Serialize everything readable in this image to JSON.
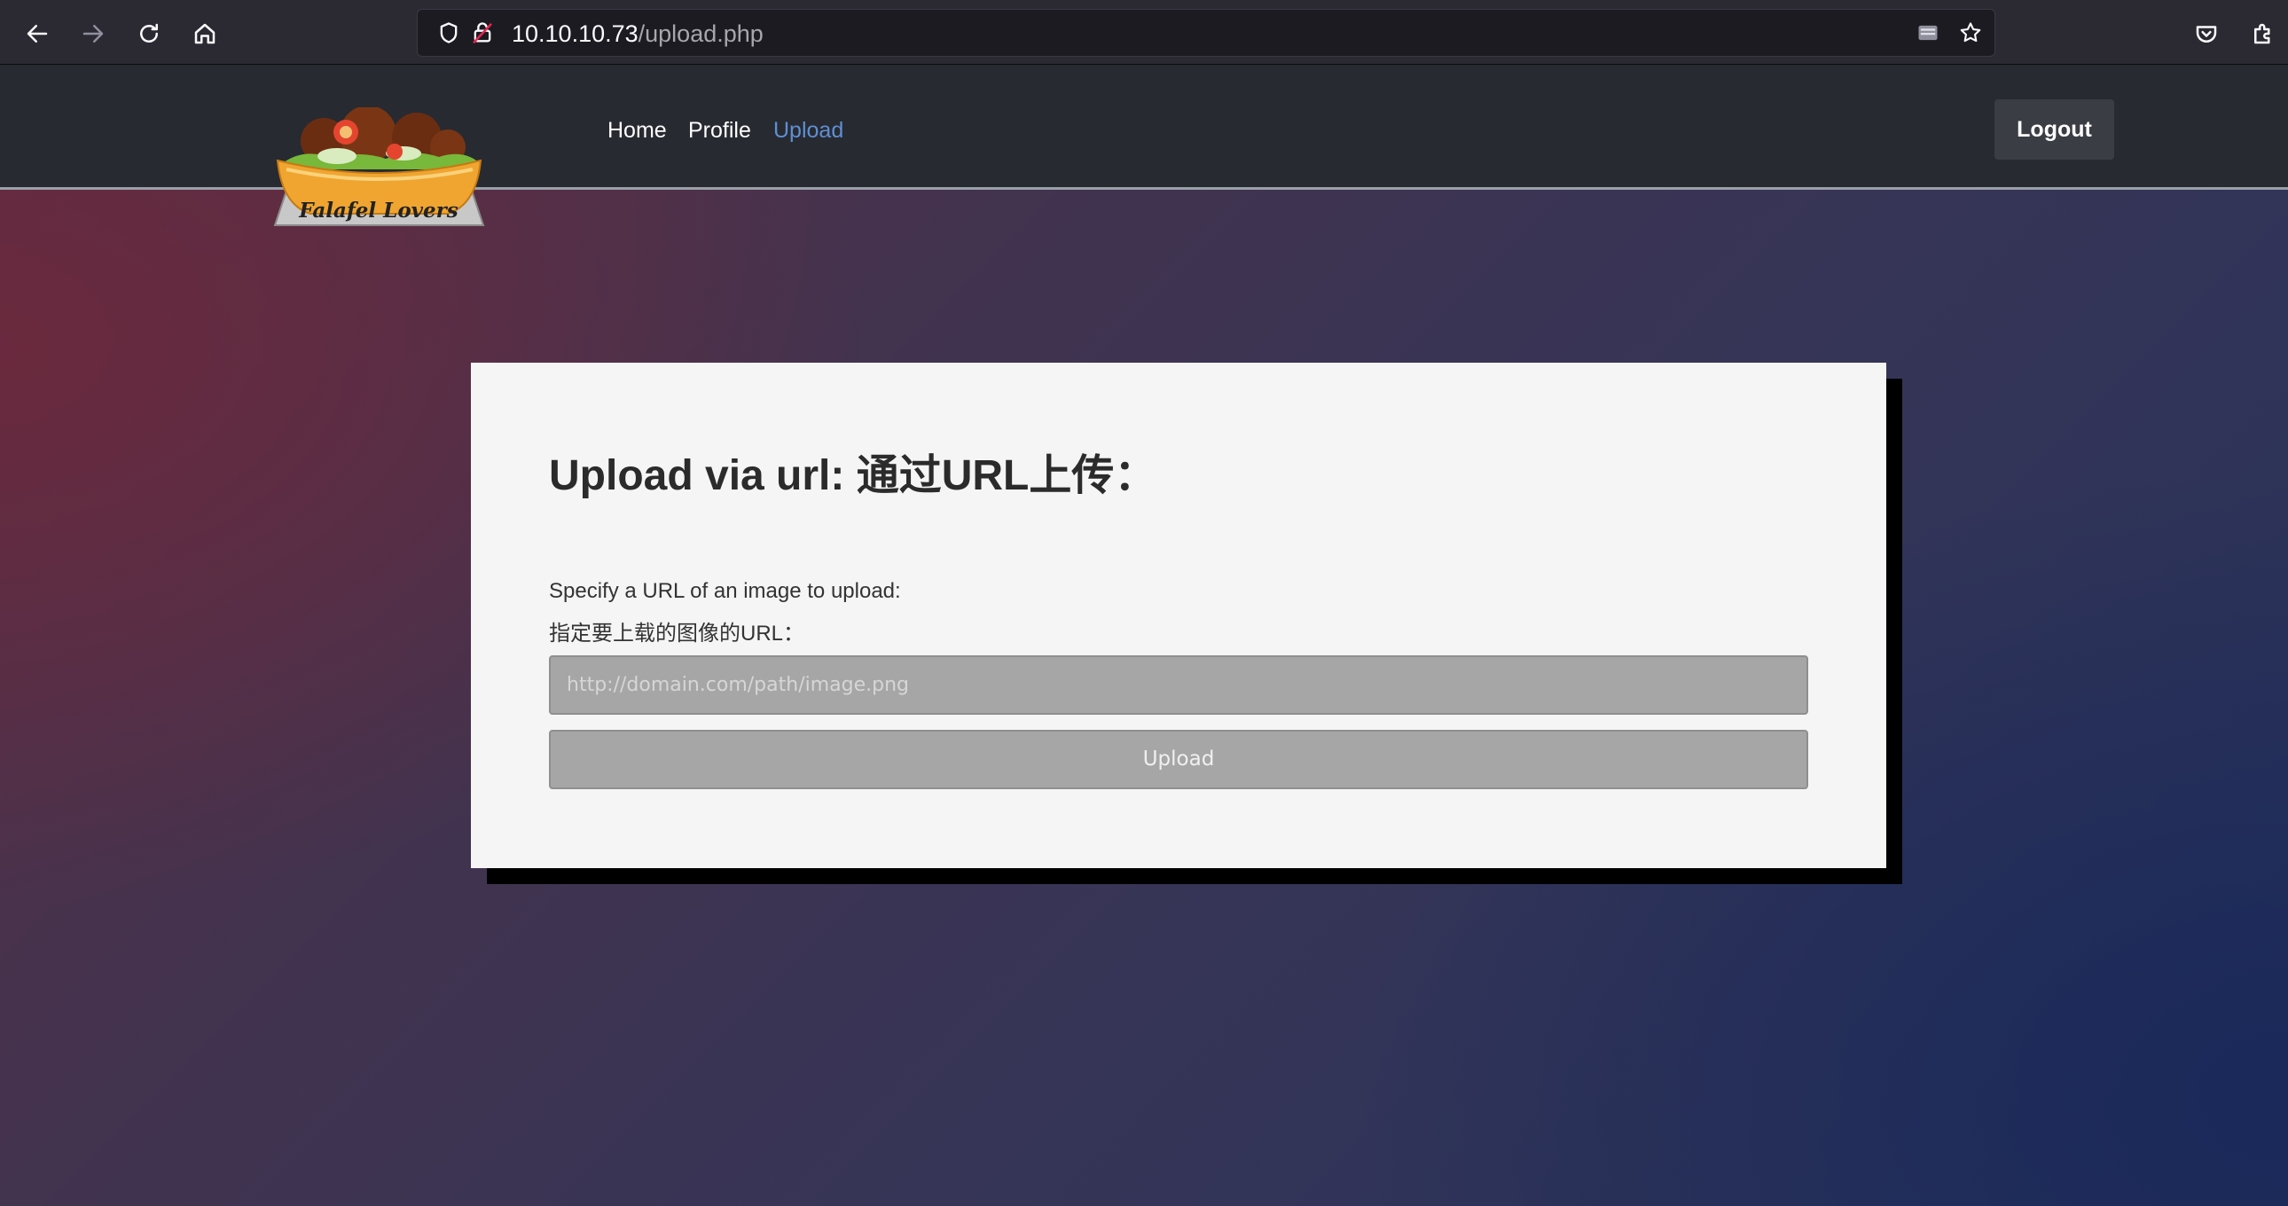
{
  "browser": {
    "url_host": "10.10.10.73",
    "url_path": "/upload.php",
    "icons": {
      "back": "arrow-left-icon",
      "forward": "arrow-right-icon",
      "reload": "reload-icon",
      "home": "home-icon",
      "tracking_protection": "shield-icon",
      "insecure_lock": "lock-warning-icon",
      "reader": "reader-view-icon",
      "bookmark": "star-icon",
      "pocket": "pocket-icon",
      "extensions": "puzzle-icon"
    }
  },
  "nav": {
    "logo_text": "Falafel Lovers",
    "links": [
      {
        "label": "Home",
        "active": false
      },
      {
        "label": "Profile",
        "active": false
      },
      {
        "label": "Upload",
        "active": true
      }
    ],
    "logout_label": "Logout",
    "active_color": "#5f8fd3"
  },
  "upload": {
    "title": "Upload via url: 通过URL上传：",
    "description_en": "Specify a URL of an image to upload:",
    "description_zh": "指定要上载的图像的URL：",
    "input_value": "",
    "input_placeholder": "http://domain.com/path/image.png",
    "button_label": "Upload"
  }
}
